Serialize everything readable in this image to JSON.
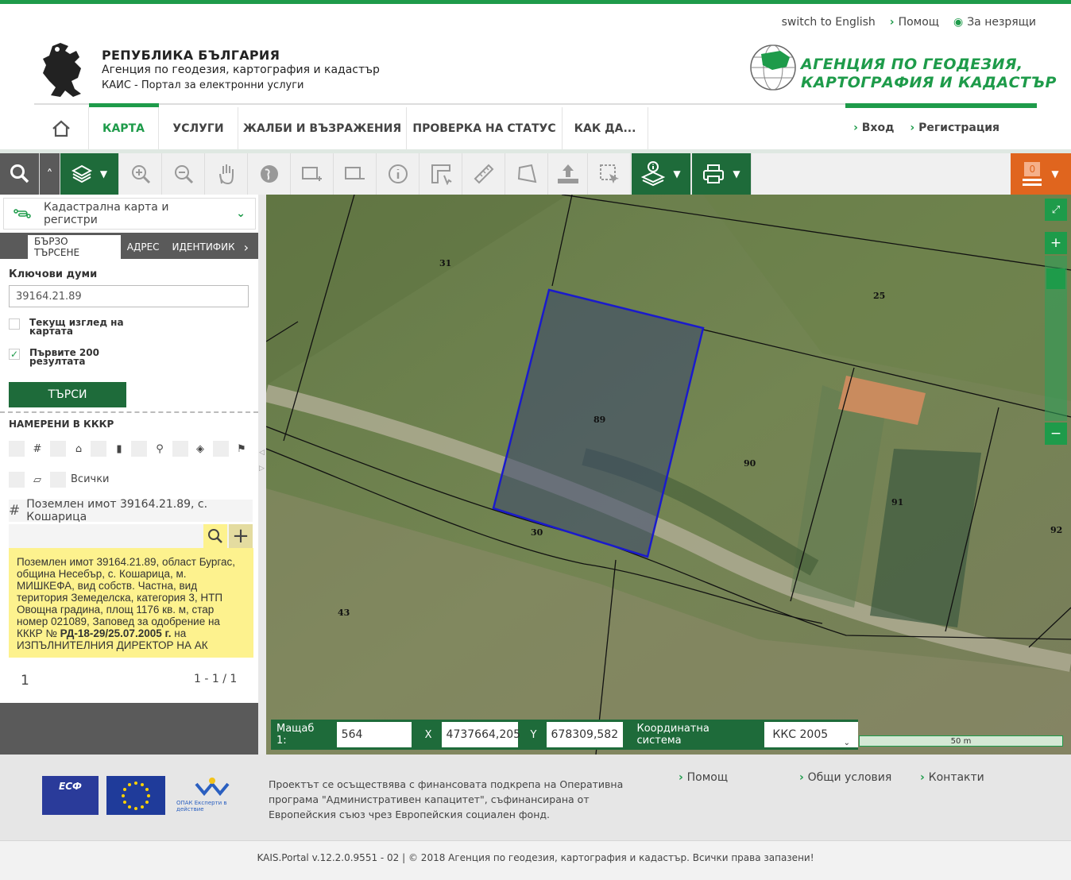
{
  "header": {
    "top_links": [
      {
        "label": "switch to English",
        "icon": "none"
      },
      {
        "label": "Помощ",
        "icon": "chevron-right-icon"
      },
      {
        "label": "За незрящи",
        "icon": "eye-icon"
      }
    ],
    "title_line1": "РЕПУБЛИКА БЪЛГАРИЯ",
    "title_line2": "Агенция по геодезия, картография и кадастър",
    "title_line3": "КАИС - Портал за електронни услуги",
    "agency_logo_text_line1": "АГЕНЦИЯ ПО ГЕОДЕЗИЯ,",
    "agency_logo_text_line2": "КАРТОГРАФИЯ И КАДАСТЪР"
  },
  "nav": {
    "items": [
      "КАРТА",
      "УСЛУГИ",
      "ЖАЛБИ И ВЪЗРАЖЕНИЯ",
      "ПРОВЕРКА НА СТАТУС",
      "КАК ДА..."
    ],
    "login": "Вход",
    "register": "Регистрация"
  },
  "toolbar": {
    "cart_count": "0"
  },
  "sidebar": {
    "layer": "Кадастрална карта и регистри",
    "tabs": [
      "БЪРЗО ТЪРСЕНЕ",
      "АДРЕС",
      "ИДЕНТИФИКА"
    ],
    "keywords_label": "Ключови думи",
    "keywords_value": "39164.21.89",
    "chk_current_view": "Текущ изглед на картата",
    "chk_first200": "Първите 200 резултата",
    "search_button": "ТЪРСИ",
    "found_label": "НАМЕРЕНИ В КККР",
    "all_label": "Всички",
    "result_title": "Поземлен имот 39164.21.89, с. Кошарица",
    "info_text": "Поземлен имот 39164.21.89, област Бургас, община Несебър, с. Кошарица, м. МИШКЕФА, вид собств. Частна, вид територия Земеделска, категория 3, НТП Овощна градина, площ 1176 кв. м, стар номер 021089, Заповед за одобрение на КККР №",
    "info_bold": "РД-18-29/25.07.2005 г.",
    "info_tail": "на ИЗПЪЛНИТЕЛНИЯ ДИРЕКТОР НА АК",
    "page_num": "1",
    "page_range": "1 - 1 / 1"
  },
  "map": {
    "parcel_labels": [
      "31",
      "25",
      "89",
      "90",
      "91",
      "92",
      "30",
      "43"
    ],
    "scale_label": "Мащаб  1:",
    "scale_value": "564",
    "x_label": "X",
    "x_value": "4737664,205",
    "y_label": "Y",
    "y_value": "678309,582",
    "crs_label": "Координатна система",
    "crs_value": "ККС 2005",
    "scalebar_label": "50 m"
  },
  "footer": {
    "project_text": "Проектът се осъществява с финансовата подкрепа на Оперативна програма \"Административен капацитет\", съфинансирана от Европейския съюз чрез Европейския социален фонд.",
    "links": [
      "Помощ",
      "Общи условия",
      "Контакти"
    ],
    "copyright": "KAIS.Portal v.12.2.0.9551 - 02  |  © 2018 Агенция по геодезия, картография и кадастър. Всички права запазени!",
    "esf_logo_text": "ЕСФ",
    "opac_logo_text": "ОПАК Експерти в действие"
  },
  "colors": {
    "brand_green": "#1e9b4a",
    "dark_green": "#1e6b3a",
    "orange": "#e0651e",
    "info_yellow": "#fdf28e",
    "parcel_outline": "#1a1acc"
  }
}
